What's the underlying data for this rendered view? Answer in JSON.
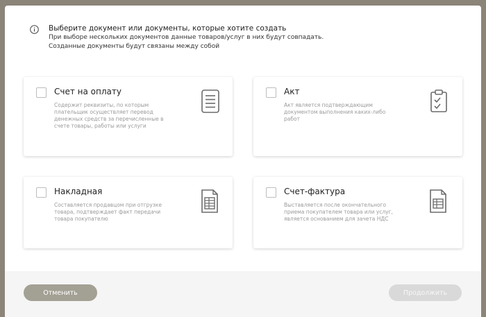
{
  "info": {
    "title": "Выберите документ или документы, которые хотите создать",
    "line1": "При выборе нескольких документов данные товаров/услуг в них будут совпадать.",
    "line2": "Созданные документы будут связаны между собой"
  },
  "cards": [
    {
      "title": "Счет на оплату",
      "desc_lines": [
        "Содержит реквизиты, по которым",
        "плательщик осуществляет перевод",
        "денежных средств за перечисленные в",
        "счете товары, работы или услуги"
      ],
      "icon": "document-lines-icon",
      "checked": false
    },
    {
      "title": "Акт",
      "desc_lines": [
        "Акт является подтверждающим",
        "документом выполнения каких-либо",
        "работ"
      ],
      "icon": "clipboard-check-icon",
      "checked": false
    },
    {
      "title": "Накладная",
      "desc_lines": [
        "Составляется продавцом при отгрузке",
        "товара, подтверждает факт передачи",
        "товара покупателю"
      ],
      "icon": "document-table-icon",
      "checked": false
    },
    {
      "title": "Счет-фактура",
      "desc_lines": [
        "Выставляется после окончательного",
        "приема покупателем товара или услуг,",
        "является основанием для зачета НДС"
      ],
      "icon": "document-table-icon",
      "checked": false
    }
  ],
  "footer": {
    "cancel_label": "Отменить",
    "continue_label": "Продолжить"
  },
  "colors": {
    "cancel_bg": "#a3a094",
    "continue_disabled_bg": "#d9d9d9"
  }
}
